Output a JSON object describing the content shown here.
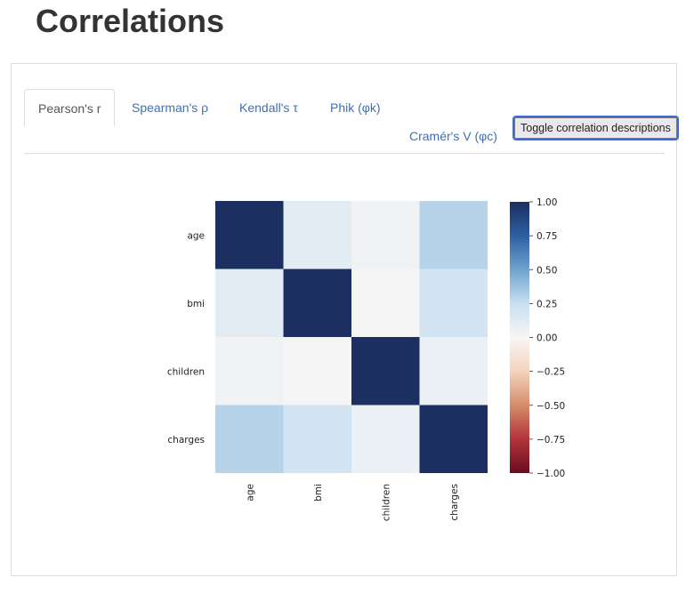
{
  "page": {
    "title": "Correlations"
  },
  "tabs": [
    {
      "label": "Pearson's r",
      "active": true
    },
    {
      "label": "Spearman's ρ",
      "active": false
    },
    {
      "label": "Kendall's τ",
      "active": false
    },
    {
      "label": "Phik (φk)",
      "active": false
    },
    {
      "label": "Cramér's V (φc)",
      "active": false
    }
  ],
  "toolbar": {
    "toggle_label": "Toggle correlation descriptions"
  },
  "colors": {
    "tab_link": "#3d71b4",
    "cmap_pos_max": "#1b2f60",
    "cmap_neutral": "#f7f6f5",
    "cmap_neg_max": "#6a0c1f"
  },
  "chart_data": {
    "type": "heatmap",
    "title": "",
    "variables": [
      "age",
      "bmi",
      "children",
      "charges"
    ],
    "row_labels": [
      "age",
      "bmi",
      "children",
      "charges"
    ],
    "col_labels": [
      "age",
      "bmi",
      "children",
      "charges"
    ],
    "matrix": [
      [
        1.0,
        0.11,
        0.04,
        0.3
      ],
      [
        0.11,
        1.0,
        0.01,
        0.2
      ],
      [
        0.04,
        0.01,
        1.0,
        0.07
      ],
      [
        0.3,
        0.2,
        0.07,
        1.0
      ]
    ],
    "colormap": "RdBu_r",
    "vmin": -1.0,
    "vmax": 1.0,
    "colorbar": {
      "ticks": [
        1.0,
        0.75,
        0.5,
        0.25,
        0.0,
        -0.25,
        -0.5,
        -0.75,
        -1.0
      ],
      "tick_labels": [
        "1.00",
        "0.75",
        "0.50",
        "0.25",
        "0.00",
        "−0.25",
        "−0.50",
        "−0.75",
        "−1.00"
      ],
      "placement": "right"
    },
    "xlabel": "",
    "ylabel": "",
    "grid": false
  }
}
